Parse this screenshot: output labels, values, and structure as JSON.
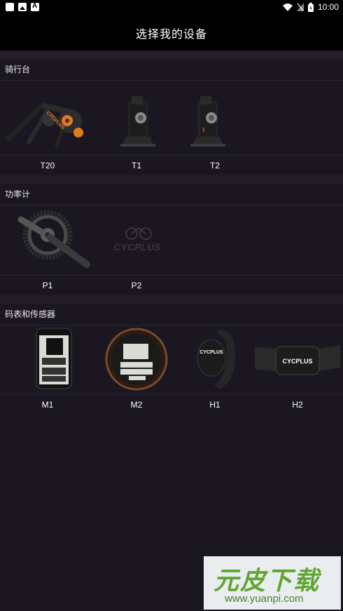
{
  "status_bar": {
    "time": "10:00",
    "icons": [
      "app-icon",
      "image-icon",
      "a-icon",
      "wifi-icon",
      "signal-icon",
      "battery-icon"
    ]
  },
  "header": {
    "title": "选择我的设备"
  },
  "sections": [
    {
      "title": "骑行台",
      "items": [
        {
          "label": "T20"
        },
        {
          "label": "T1"
        },
        {
          "label": "T2"
        }
      ]
    },
    {
      "title": "功率计",
      "items": [
        {
          "label": "P1"
        },
        {
          "label": "P2",
          "placeholder_logo": "CYCPLUS"
        }
      ]
    },
    {
      "title": "码表和传感器",
      "items": [
        {
          "label": "M1"
        },
        {
          "label": "M2"
        },
        {
          "label": "H1"
        },
        {
          "label": "H2"
        }
      ]
    }
  ],
  "watermark": {
    "brand": "元皮下载",
    "url": "www.yuanpi.com"
  },
  "colors": {
    "background": "#1a1620",
    "header": "#000000",
    "accent_orange": "#e07a1f"
  }
}
